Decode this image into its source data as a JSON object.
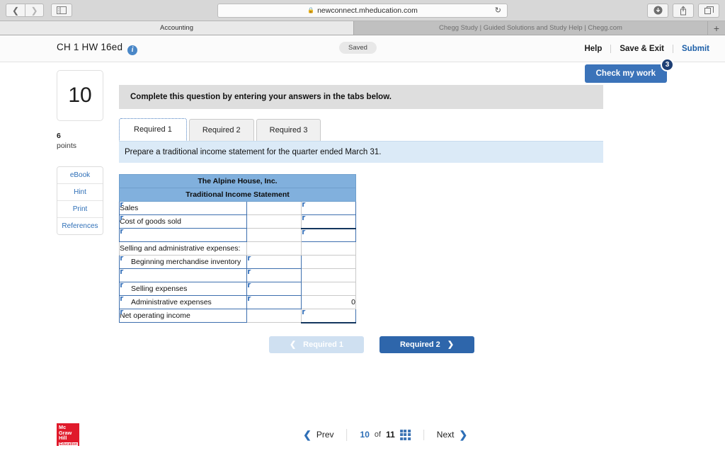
{
  "browser": {
    "url": "newconnect.mheducation.com",
    "lock_icon": "lock-icon",
    "reload_icon": "reload-icon",
    "back_icon": "back-arrow-icon",
    "forward_icon": "forward-arrow-icon",
    "sidebar_icon": "sidebar-toggle-icon",
    "download_icon": "download-icon",
    "share_icon": "share-icon",
    "tabs_overview_icon": "tabs-overview-icon",
    "new_tab_label": "+",
    "tabs": [
      {
        "title": "Accounting",
        "active": true
      },
      {
        "title": "Chegg Study | Guided Solutions and Study Help | Chegg.com",
        "active": false
      }
    ]
  },
  "header": {
    "title": "CH 1 HW 16ed",
    "info_icon": "info-icon",
    "status": "Saved",
    "links": [
      {
        "label": "Help"
      },
      {
        "label": "Save & Exit"
      },
      {
        "label": "Submit"
      }
    ]
  },
  "check_my_work": {
    "label": "Check my work",
    "badge": "3"
  },
  "rail": {
    "question_number": "10",
    "points_value": "6",
    "points_label": "points",
    "buttons": [
      {
        "label": "eBook"
      },
      {
        "label": "Hint"
      },
      {
        "label": "Print"
      },
      {
        "label": "References"
      }
    ]
  },
  "main": {
    "instruction": "Complete this question by entering your answers in the tabs below.",
    "tabs": [
      {
        "label": "Required 1",
        "active": true
      },
      {
        "label": "Required 2",
        "active": false
      },
      {
        "label": "Required 3",
        "active": false
      }
    ],
    "requirement_text": "Prepare a traditional income statement for the quarter ended March 31."
  },
  "statement": {
    "company": "The Alpine House, Inc.",
    "subtitle": "Traditional Income Statement",
    "rows": [
      {
        "label": "Sales",
        "indent": false,
        "label_editable": true,
        "mid": "",
        "mid_editable": false,
        "right": "",
        "right_editable": true,
        "right_rule": "none"
      },
      {
        "label": "Cost of goods sold",
        "indent": false,
        "label_editable": true,
        "mid": "",
        "mid_editable": false,
        "right": "",
        "right_editable": true,
        "right_rule": "bottom"
      },
      {
        "label": "",
        "indent": false,
        "label_editable": true,
        "mid": "",
        "mid_editable": false,
        "right": "",
        "right_editable": true,
        "right_rule": "top"
      },
      {
        "label": "Selling and administrative expenses:",
        "indent": false,
        "label_editable": false,
        "mid": "",
        "mid_editable": false,
        "right": "",
        "right_editable": false,
        "right_rule": "none"
      },
      {
        "label": "Beginning merchandise inventory",
        "indent": true,
        "label_editable": true,
        "mid": "",
        "mid_editable": true,
        "right": "",
        "right_editable": false,
        "right_rule": "none"
      },
      {
        "label": "",
        "indent": true,
        "label_editable": true,
        "mid": "",
        "mid_editable": true,
        "right": "",
        "right_editable": false,
        "right_rule": "none"
      },
      {
        "label": "Selling expenses",
        "indent": true,
        "label_editable": true,
        "mid": "",
        "mid_editable": true,
        "right": "",
        "right_editable": false,
        "right_rule": "none"
      },
      {
        "label": "Administrative expenses",
        "indent": true,
        "label_editable": true,
        "mid": "",
        "mid_editable": true,
        "right": "0",
        "right_editable": false,
        "right_rule": "none"
      },
      {
        "label": "Net operating income",
        "indent": false,
        "label_editable": true,
        "mid": "",
        "mid_editable": false,
        "right": "",
        "right_editable": true,
        "right_rule": "bottom"
      }
    ]
  },
  "req_nav": {
    "prev_label": "Required 1",
    "prev_icon": "chevron-left-icon",
    "next_label": "Required 2",
    "next_icon": "chevron-right-icon"
  },
  "footer": {
    "logo_line1": "Mc",
    "logo_line2": "Graw",
    "logo_line3": "Hill",
    "logo_line4": "Education",
    "prev_label": "Prev",
    "prev_icon": "chevron-left-icon",
    "current_page": "10",
    "of_label": "of",
    "total_pages": "11",
    "grid_icon": "grid-icon",
    "next_label": "Next",
    "next_icon": "chevron-right-icon"
  },
  "colors": {
    "accent_blue": "#2e66ab",
    "table_header_blue": "#81b0dd",
    "banner_blue": "#dbeaf7",
    "banner_gray": "#dedede",
    "mh_red": "#e01a2b",
    "input_border": "#3d6fae"
  }
}
